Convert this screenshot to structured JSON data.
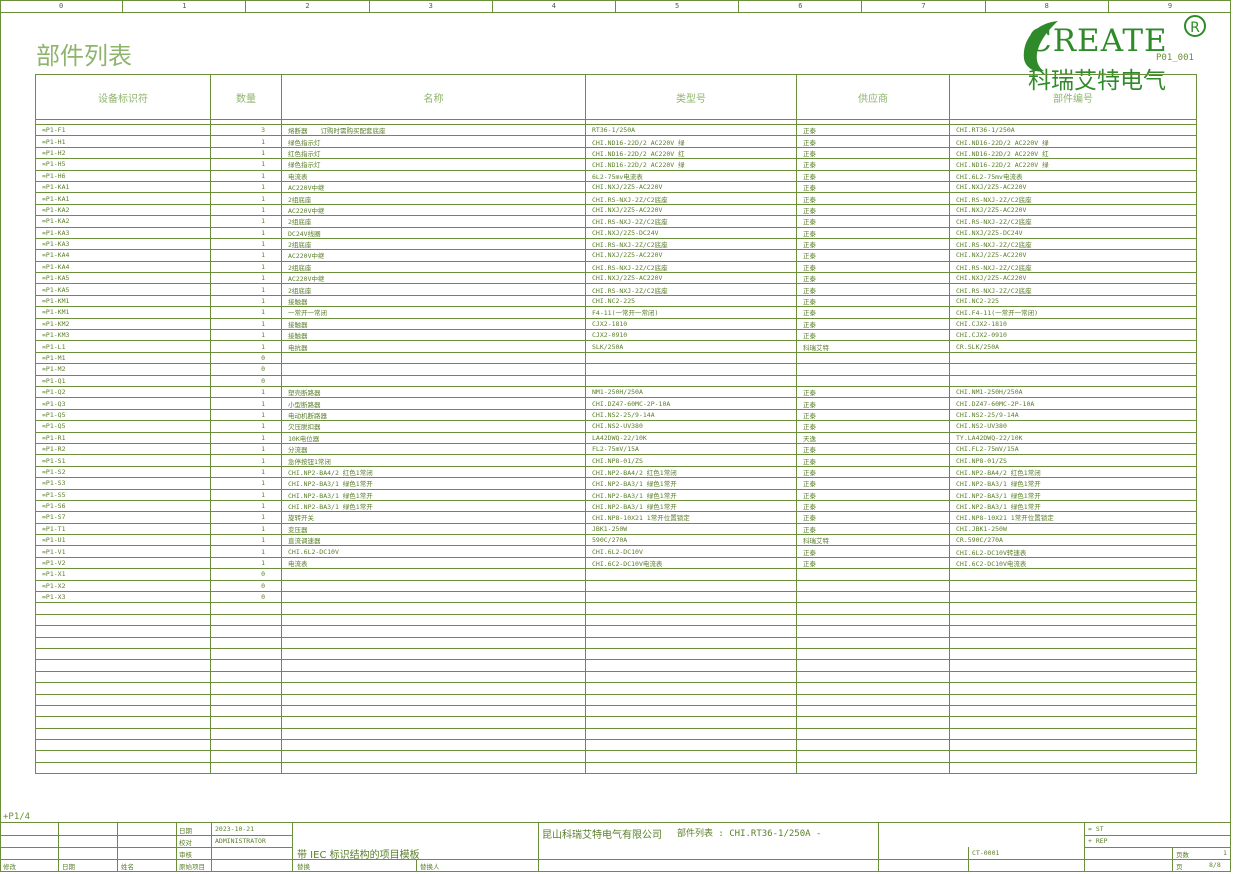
{
  "ruler": [
    "0",
    "1",
    "2",
    "3",
    "4",
    "5",
    "6",
    "7",
    "8",
    "9"
  ],
  "title": "部件列表",
  "page_id": "P01_001",
  "logo": {
    "text": "CREATE",
    "reg": "R",
    "cn": "科瑞艾特电气"
  },
  "headers": [
    "设备标识符",
    "数量",
    "名称",
    "类型号",
    "供应商",
    "部件编号"
  ],
  "rows": [
    [
      "=P1-F1",
      "3",
      "熔断器　　订购时需购买配套底座",
      "RT36-1/250A",
      "正泰",
      "CHI.RT36-1/250A"
    ],
    [
      "=P1-H1",
      "1",
      "绿色指示灯",
      "CHI.ND16-22D/2 AC220V 绿",
      "正泰",
      "CHI.ND16-22D/2 AC220V 绿"
    ],
    [
      "=P1-H2",
      "1",
      "红色指示灯",
      "CHI.ND16-22D/2 AC220V 红",
      "正泰",
      "CHI.ND16-22D/2 AC220V 红"
    ],
    [
      "=P1-H5",
      "1",
      "绿色指示灯",
      "CHI.ND16-22D/2 AC220V 绿",
      "正泰",
      "CHI.ND16-22D/2 AC220V 绿"
    ],
    [
      "=P1-H6",
      "1",
      "电流表",
      "6L2-75mv电流表",
      "正泰",
      "CHI.6L2-75mv电流表"
    ],
    [
      "=P1-KA1",
      "1",
      "AC220V中继",
      "CHI.NXJ/2Z5-AC220V",
      "正泰",
      "CHI.NXJ/2Z5-AC220V"
    ],
    [
      "=P1-KA1",
      "1",
      "2组底座",
      "CHI.RS-NXJ-2Z/C2底座",
      "正泰",
      "CHI.RS-NXJ-2Z/C2底座"
    ],
    [
      "=P1-KA2",
      "1",
      "AC220V中继",
      "CHI.NXJ/2Z5-AC220V",
      "正泰",
      "CHI.NXJ/2Z5-AC220V"
    ],
    [
      "=P1-KA2",
      "1",
      "2组底座",
      "CHI.RS-NXJ-2Z/C2底座",
      "正泰",
      "CHI.RS-NXJ-2Z/C2底座"
    ],
    [
      "=P1-KA3",
      "1",
      "DC24V线圈",
      "CHI.NXJ/2Z5-DC24V",
      "正泰",
      "CHI.NXJ/2Z5-DC24V"
    ],
    [
      "=P1-KA3",
      "1",
      "2组底座",
      "CHI.RS-NXJ-2Z/C2底座",
      "正泰",
      "CHI.RS-NXJ-2Z/C2底座"
    ],
    [
      "=P1-KA4",
      "1",
      "AC220V中继",
      "CHI.NXJ/2Z5-AC220V",
      "正泰",
      "CHI.NXJ/2Z5-AC220V"
    ],
    [
      "=P1-KA4",
      "1",
      "2组底座",
      "CHI.RS-NXJ-2Z/C2底座",
      "正泰",
      "CHI.RS-NXJ-2Z/C2底座"
    ],
    [
      "=P1-KA5",
      "1",
      "AC220V中继",
      "CHI.NXJ/2Z5-AC220V",
      "正泰",
      "CHI.NXJ/2Z5-AC220V"
    ],
    [
      "=P1-KA5",
      "1",
      "2组底座",
      "CHI.RS-NXJ-2Z/C2底座",
      "正泰",
      "CHI.RS-NXJ-2Z/C2底座"
    ],
    [
      "=P1-KM1",
      "1",
      "接触器",
      "CHI.NC2-225",
      "正泰",
      "CHI.NC2-225"
    ],
    [
      "=P1-KM1",
      "1",
      "一常开一常闭",
      "F4-11(一常开一常闭)",
      "正泰",
      "CHI.F4-11(一常开一常闭)"
    ],
    [
      "=P1-KM2",
      "1",
      "接触器",
      "CJX2-1810",
      "正泰",
      "CHI.CJX2-1810"
    ],
    [
      "=P1-KM3",
      "1",
      "接触器",
      "CJX2-0910",
      "正泰",
      "CHI.CJX2-0910"
    ],
    [
      "=P1-L1",
      "1",
      "电抗器",
      "SLK/250A",
      "科瑞艾特",
      "CR.SLK/250A"
    ],
    [
      "=P1-M1",
      "0",
      "",
      "",
      "",
      ""
    ],
    [
      "=P1-M2",
      "0",
      "",
      "",
      "",
      ""
    ],
    [
      "=P1-Q1",
      "0",
      "",
      "",
      "",
      ""
    ],
    [
      "=P1-Q2",
      "1",
      "塑壳断路器",
      "NM1-250H/250A",
      "正泰",
      "CHI.NM1-250H/250A"
    ],
    [
      "=P1-Q3",
      "1",
      "小型断路器",
      "CHI.DZ47-60MC-2P-10A",
      "正泰",
      "CHI.DZ47-60MC-2P-10A"
    ],
    [
      "=P1-Q5",
      "1",
      "电动机断路器",
      "CHI.NS2-25/9-14A",
      "正泰",
      "CHI.NS2-25/9-14A"
    ],
    [
      "=P1-Q5",
      "1",
      "欠压脱扣器",
      "CHI.NS2-UV380",
      "正泰",
      "CHI.NS2-UV380"
    ],
    [
      "=P1-R1",
      "1",
      "10K电位器",
      "LA42DWQ-22/10K",
      "天逸",
      "TY.LA42DWQ-22/10K"
    ],
    [
      "=P1-R2",
      "1",
      "分流器",
      "FL2-75mV/15A",
      "正泰",
      "CHI.FL2-75mV/15A"
    ],
    [
      "=P1-S1",
      "1",
      "急停按钮1常闭",
      "CHI.NP8-01/ZS",
      "正泰",
      "CHI.NP8-01/ZS"
    ],
    [
      "=P1-S2",
      "1",
      "CHI.NP2-BA4/2 红色1常闭",
      "CHI.NP2-BA4/2 红色1常闭",
      "正泰",
      "CHI.NP2-BA4/2 红色1常闭"
    ],
    [
      "=P1-S3",
      "1",
      "CHI.NP2-BA3/1 绿色1常开",
      "CHI.NP2-BA3/1 绿色1常开",
      "正泰",
      "CHI.NP2-BA3/1 绿色1常开"
    ],
    [
      "=P1-S5",
      "1",
      "CHI.NP2-BA3/1 绿色1常开",
      "CHI.NP2-BA3/1 绿色1常开",
      "正泰",
      "CHI.NP2-BA3/1 绿色1常开"
    ],
    [
      "=P1-S6",
      "1",
      "CHI.NP2-BA3/1 绿色1常开",
      "CHI.NP2-BA3/1 绿色1常开",
      "正泰",
      "CHI.NP2-BA3/1 绿色1常开"
    ],
    [
      "=P1-S7",
      "1",
      "旋转开关",
      "CHI.NP8-10X21 1常开位置锁定",
      "正泰",
      "CHI.NP8-10X21 1常开位置锁定"
    ],
    [
      "=P1-T1",
      "1",
      "变压器",
      "JBK1-250W",
      "正泰",
      "CHI.JBK1-250W"
    ],
    [
      "=P1-U1",
      "1",
      "直流调速器",
      "590C/270A",
      "科瑞艾特",
      "CR.590C/270A"
    ],
    [
      "=P1-V1",
      "1",
      "CHI.6L2-DC10V",
      "CHI.6L2-DC10V",
      "正泰",
      "CHI.6L2-DC10V转速表"
    ],
    [
      "=P1-V2",
      "1",
      "电流表",
      "CHI.6C2-DC10V电流表",
      "正泰",
      "CHI.6C2-DC10V电流表"
    ],
    [
      "=P1-X1",
      "0",
      "",
      "",
      "",
      ""
    ],
    [
      "=P1-X2",
      "0",
      "",
      "",
      "",
      ""
    ],
    [
      "=P1-X3",
      "0",
      "",
      "",
      "",
      ""
    ]
  ],
  "empty_row_count": 15,
  "page_ref": "+P1/4",
  "titleblock": {
    "date_label": "日期",
    "date_value": "2023-10-21",
    "check_label": "校对",
    "check_value": "ADMINISTRATOR",
    "review_label": "审核",
    "orig_label": "原始项目",
    "modify_label": "修改",
    "date2_label": "日期",
    "name_label": "姓名",
    "project_desc": "带 IEC 标识结构的项目模板",
    "replace_label": "替换",
    "replaced_by_label": "替换人",
    "company": "昆山科瑞艾特电气有限公司",
    "sheet_title": "部件列表 : CHI.RT36-1/250A -",
    "st": "= ST",
    "rep": "+ REP",
    "drawing_no": "CT-0001",
    "pages_label": "页数",
    "pages_value": "1",
    "page_label": "页",
    "page_value": "8/8"
  }
}
